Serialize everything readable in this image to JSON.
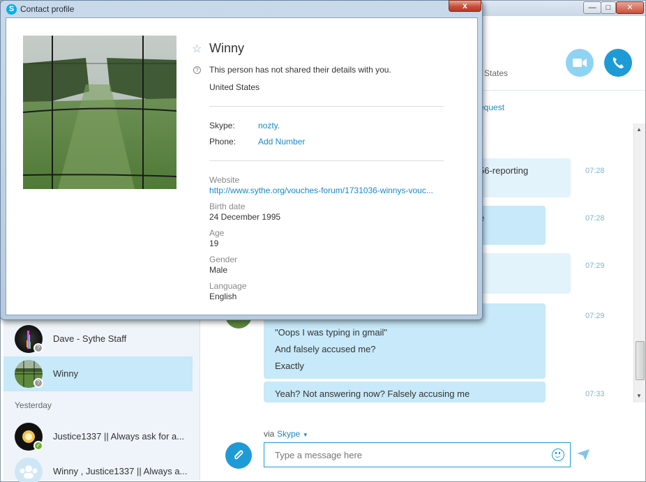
{
  "main": {
    "header_country_partial": "d States",
    "header_request_partial": "equest",
    "messages": [
      {
        "partial": "56-reporting",
        "time": "07:28"
      },
      {
        "partial": "e",
        "time": "07:28"
      },
      {
        "partial": "",
        "time": "07:29"
      },
      {
        "lines": [
          "\"Oops I was typing in gmail\"",
          "And falsely accused me?",
          "Exactly"
        ],
        "time": "07:29"
      },
      {
        "lines": [
          "Yeah? Not answering now? Falsely accusing me"
        ],
        "time": "07:33"
      }
    ],
    "via_label": "via",
    "via_service": "Skype",
    "compose_placeholder": "Type a message here"
  },
  "sidebar": {
    "contacts": [
      {
        "name": "Dave - Sythe Staff",
        "status": "unknown"
      },
      {
        "name": "Winny",
        "status": "unknown",
        "selected": true
      }
    ],
    "section_label": "Yesterday",
    "recent": [
      {
        "name": "Justice1337 || Always ask for a...",
        "status": "online"
      },
      {
        "name": "Winny , Justice1337 || Always a...",
        "status": "group"
      }
    ]
  },
  "dialog": {
    "title": "Contact profile",
    "close_label": "x",
    "name": "Winny",
    "privacy_notice": "This person has not shared their details with you.",
    "country": "United States",
    "skype_label": "Skype:",
    "skype_value": "nozty.",
    "phone_label": "Phone:",
    "phone_value": "Add Number",
    "website_label": "Website",
    "website_value": "http://www.sythe.org/vouches-forum/1731036-winnys-vouc...",
    "birth_label": "Birth date",
    "birth_value": "24 December 1995",
    "age_label": "Age",
    "age_value": "19",
    "gender_label": "Gender",
    "gender_value": "Male",
    "language_label": "Language",
    "language_value": "English"
  },
  "colors": {
    "accent": "#1e9bd7",
    "bubble": "#c7e9f9",
    "sidebar_bg": "#eef4f9",
    "selected_row": "#c7e9f9",
    "online": "#6bb32b"
  }
}
